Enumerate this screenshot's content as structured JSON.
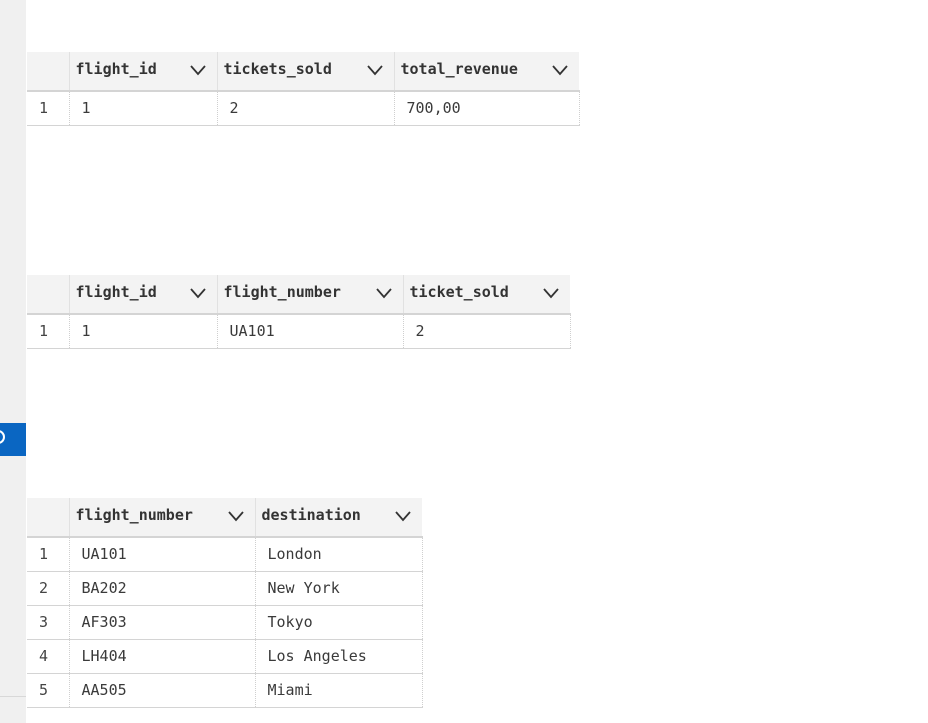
{
  "grid1": {
    "columns": [
      "flight_id",
      "tickets_sold",
      "total_revenue"
    ],
    "rows": [
      {
        "num": "1",
        "cells": [
          "1",
          "2",
          "700,00"
        ]
      }
    ]
  },
  "grid2": {
    "columns": [
      "flight_id",
      "flight_number",
      "ticket_sold"
    ],
    "rows": [
      {
        "num": "1",
        "cells": [
          "1",
          "UA101",
          "2"
        ]
      }
    ]
  },
  "grid3": {
    "columns": [
      "flight_number",
      "destination"
    ],
    "rows": [
      {
        "num": "1",
        "cells": [
          "UA101",
          "London"
        ]
      },
      {
        "num": "2",
        "cells": [
          "BA202",
          "New York"
        ]
      },
      {
        "num": "3",
        "cells": [
          "AF303",
          "Tokyo"
        ]
      },
      {
        "num": "4",
        "cells": [
          "LH404",
          "Los Angeles"
        ]
      },
      {
        "num": "5",
        "cells": [
          "AA505",
          "Miami"
        ]
      }
    ]
  },
  "icons": {
    "column_menu": "chevron-down-icon",
    "side_tab": "circle-icon"
  },
  "colors": {
    "side_tab": "#0a66c2",
    "header_bg": "#f3f3f3",
    "left_strip": "#f0f0f0"
  }
}
